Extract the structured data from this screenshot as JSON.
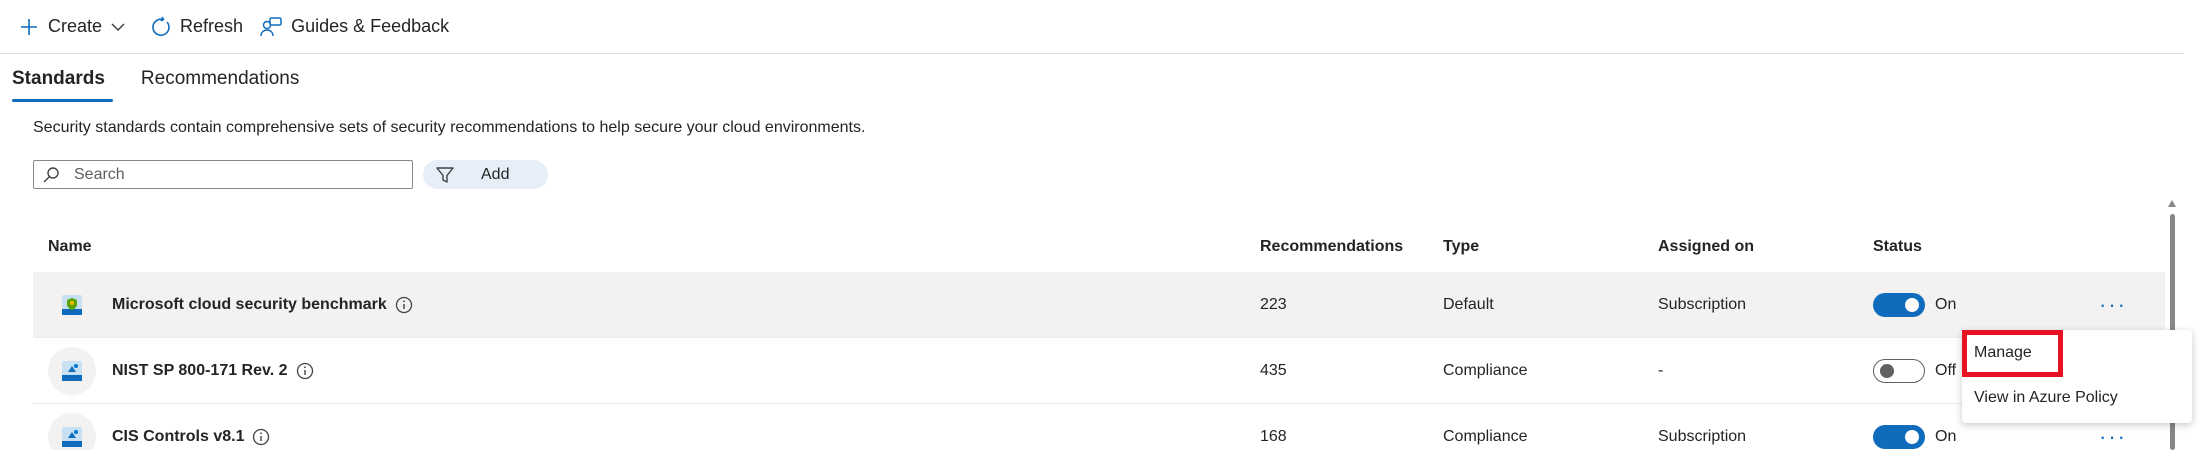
{
  "toolbar": {
    "create_label": "Create",
    "refresh_label": "Refresh",
    "guides_label": "Guides & Feedback"
  },
  "tabs": [
    {
      "label": "Standards",
      "active": true
    },
    {
      "label": "Recommendations",
      "active": false
    }
  ],
  "description": "Security standards contain comprehensive sets of security recommendations to help secure your cloud environments.",
  "search": {
    "placeholder": "Search",
    "value": ""
  },
  "filter": {
    "label": "Add"
  },
  "table": {
    "columns": [
      "Name",
      "Recommendations",
      "Type",
      "Assigned on",
      "Status"
    ],
    "rows": [
      {
        "name": "Microsoft cloud security benchmark",
        "recommendations": "223",
        "type": "Default",
        "assigned_on": "Subscription",
        "status": "On"
      },
      {
        "name": "NIST SP 800-171 Rev. 2",
        "recommendations": "435",
        "type": "Compliance",
        "assigned_on": "-",
        "status": "Off"
      },
      {
        "name": "CIS Controls v8.1",
        "recommendations": "168",
        "type": "Compliance",
        "assigned_on": "Subscription",
        "status": "On"
      }
    ]
  },
  "context_menu": {
    "items": [
      "Manage",
      "View in Azure Policy"
    ]
  },
  "colors": {
    "accent": "#0f6cbd",
    "highlight": "#e81123"
  }
}
